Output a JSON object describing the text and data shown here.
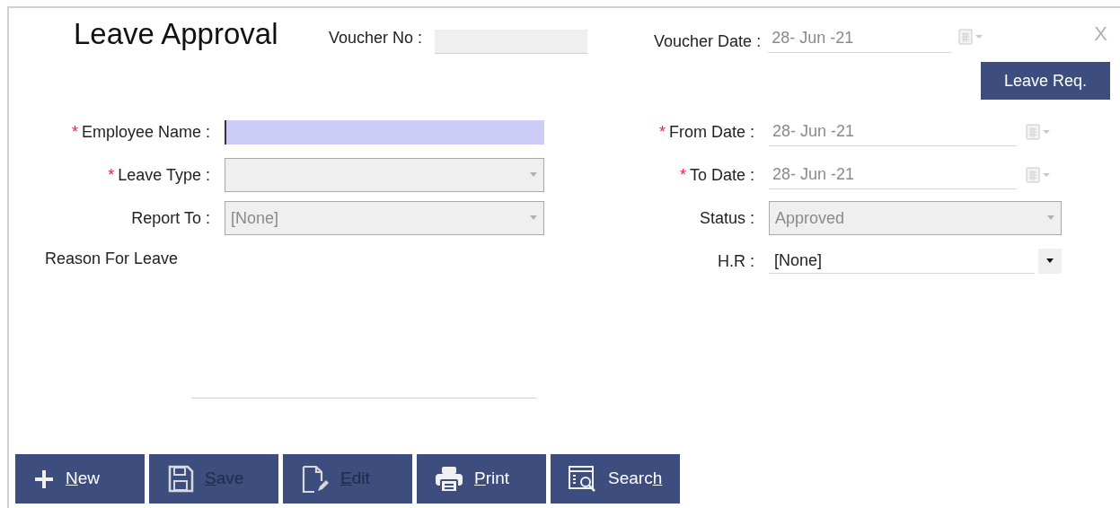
{
  "window": {
    "title": "Leave Approval",
    "close": "X"
  },
  "voucher_no": {
    "label": "Voucher No :"
  },
  "voucher_date": {
    "label": "Voucher Date :",
    "value": "28- Jun -21"
  },
  "leave_req_button": "Leave Req.",
  "left_fields": [
    {
      "kind": "text",
      "label": "Employee Name :",
      "required_mark": "*",
      "focused": true
    },
    {
      "kind": "dropdown",
      "label": "Leave Type :",
      "required_mark": "*",
      "disabled": true
    },
    {
      "kind": "dropdown",
      "label": "Report To :",
      "disabled": true,
      "value": "[None]"
    }
  ],
  "reason": {
    "label": "Reason For Leave"
  },
  "right_fields": [
    {
      "kind": "date",
      "label": "From Date :",
      "required_mark": "*",
      "value": "28- Jun -21"
    },
    {
      "kind": "date",
      "label": "To Date :",
      "required_mark": "*",
      "value": "28- Jun -21"
    },
    {
      "kind": "dropdown",
      "label": "Status :",
      "disabled": true,
      "value": "Approved"
    },
    {
      "kind": "dropdown",
      "label": "H.R :",
      "disabled": false,
      "value": "[None]"
    }
  ],
  "toolbar": [
    {
      "kind": "plus",
      "key": "N",
      "post": "ew",
      "disabled": false
    },
    {
      "kind": "save",
      "key": "S",
      "post": "ave",
      "disabled": true
    },
    {
      "kind": "edit",
      "key": "E",
      "post": "dit",
      "disabled": true
    },
    {
      "kind": "print",
      "key": "P",
      "post": "rint",
      "disabled": false
    },
    {
      "kind": "search",
      "pre": "Searc",
      "key": "h",
      "disabled": false
    }
  ]
}
